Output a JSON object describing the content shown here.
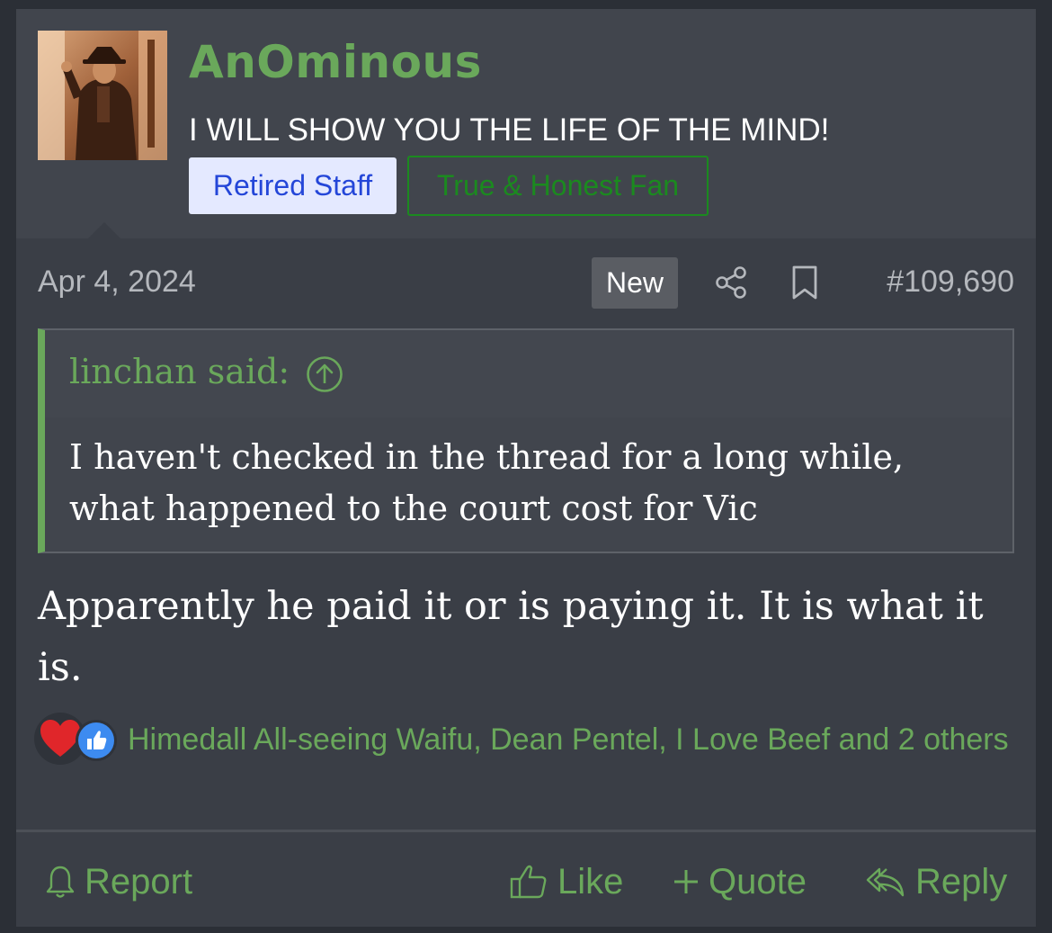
{
  "user": {
    "name": "AnOminous",
    "title": "I WILL SHOW YOU THE LIFE OF THE MIND!",
    "banners": [
      "Retired Staff",
      "True & Honest Fan"
    ]
  },
  "post": {
    "date": "Apr 4, 2024",
    "badge": "New",
    "number": "#109,690",
    "quote": {
      "author": "linchan said:",
      "text": "I haven't checked in the thread for a long while, what happened to the court cost for Vic"
    },
    "message": "Apparently he paid it or is paying it. It is what it is.",
    "reactions": {
      "icons": [
        "heart-icon",
        "like-icon"
      ],
      "text": "Himedall All-seeing Waifu, Dean Pentel, I Love Beef and 2 others"
    }
  },
  "actions": {
    "report": "Report",
    "like": "Like",
    "quote": "Quote",
    "reply": "Reply"
  },
  "colors": {
    "accent": "#6aa85b",
    "background": "#3a3e46",
    "staff_banner_bg": "#e4e9ff",
    "staff_banner_text": "#2446d8",
    "fan_banner": "#1b8a1f"
  }
}
